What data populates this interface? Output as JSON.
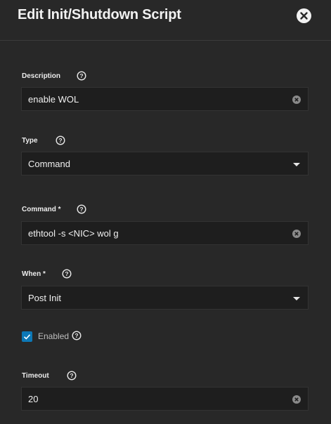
{
  "dialog": {
    "title": "Edit Init/Shutdown Script"
  },
  "fields": {
    "description": {
      "label": "Description",
      "value": "enable WOL"
    },
    "type": {
      "label": "Type",
      "value": "Command"
    },
    "command": {
      "label": "Command *",
      "value": "ethtool -s <NIC> wol g"
    },
    "when": {
      "label": "When *",
      "value": "Post Init"
    },
    "enabled": {
      "label": "Enabled",
      "checked": true
    },
    "timeout": {
      "label": "Timeout",
      "value": "20"
    }
  },
  "colors": {
    "background": "#282828",
    "field_background": "#1e1e1e",
    "checkbox_accent": "#0d78b6"
  },
  "icons": {
    "close": "close-icon",
    "help": "help-circle-icon",
    "clear": "clear-x-icon",
    "dropdown": "caret-down-icon",
    "checkbox": "checkmark-icon"
  }
}
